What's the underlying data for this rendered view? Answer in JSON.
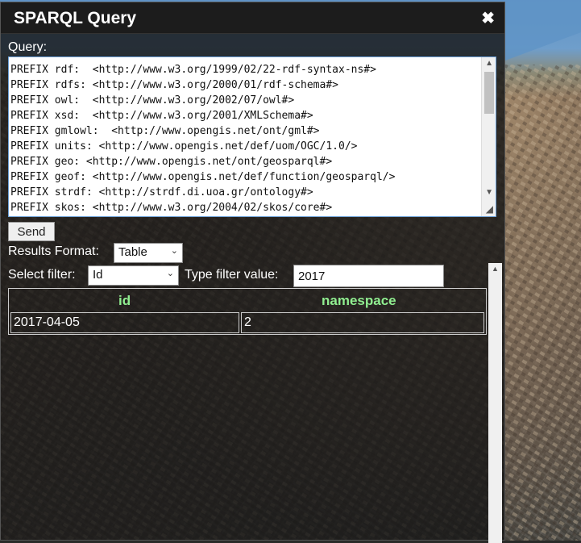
{
  "window": {
    "title": "SPARQL Query",
    "close_glyph": "✖"
  },
  "query": {
    "label": "Query:",
    "text": "PREFIX rdf:  <http://www.w3.org/1999/02/22-rdf-syntax-ns#>\nPREFIX rdfs: <http://www.w3.org/2000/01/rdf-schema#>\nPREFIX owl:  <http://www.w3.org/2002/07/owl#>\nPREFIX xsd:  <http://www.w3.org/2001/XMLSchema#>\nPREFIX gmlowl:  <http://www.opengis.net/ont/gml#>\nPREFIX units: <http://www.opengis.net/def/uom/OGC/1.0/>\nPREFIX geo: <http://www.opengis.net/ont/geosparql#>\nPREFIX geof: <http://www.opengis.net/def/function/geosparql/>\nPREFIX strdf: <http://strdf.di.uoa.gr/ontology#>\nPREFIX skos: <http://www.w3.org/2004/02/skos/core#>"
  },
  "send_label": "Send",
  "results_format": {
    "label": "Results Format:",
    "selected": "Table"
  },
  "filter": {
    "select_label": "Select filter:",
    "selected": "Id",
    "value_label": "Type filter value:",
    "value": "2017"
  },
  "table": {
    "headers": [
      "id",
      "namespace"
    ],
    "rows": [
      [
        "2017-04-05",
        "2"
      ]
    ]
  },
  "colors": {
    "header_text": "#90ee90",
    "panel_bg": "#161616"
  }
}
